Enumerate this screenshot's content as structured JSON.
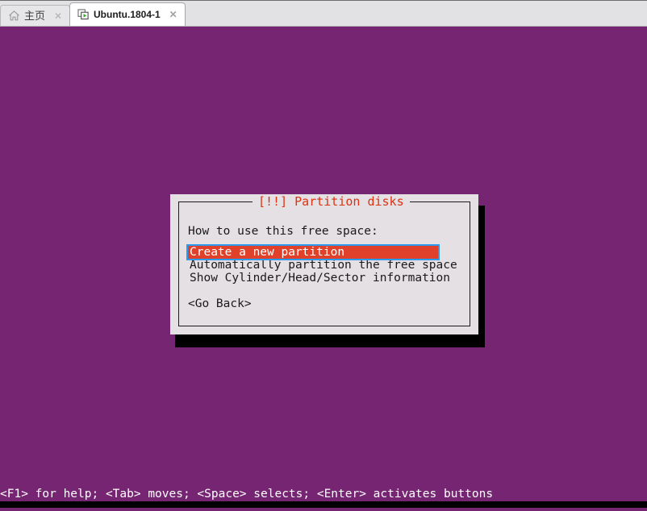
{
  "window": {
    "tabs": [
      {
        "label": "主页",
        "icon": "home-icon",
        "close_glyph": "✕",
        "active": false
      },
      {
        "label": "Ubuntu.1804-1",
        "icon": "virtual-machine-icon",
        "close_glyph": "✕",
        "active": true
      }
    ]
  },
  "console": {
    "background_color": "#762572",
    "dialog": {
      "title": "[!!] Partition disks",
      "title_color": "#dd3311",
      "background_color": "#e4e0e4",
      "prompt": "How to use this free space:",
      "menu_items": [
        {
          "label": "Create a new partition",
          "selected": true
        },
        {
          "label": "Automatically partition the free space",
          "selected": false
        },
        {
          "label": "Show Cylinder/Head/Sector information",
          "selected": false
        }
      ],
      "selected_background_color": "#e0412a",
      "focus_border_color": "#2a9bef",
      "go_back_button": "<Go Back>"
    },
    "status_bar": "<F1> for help; <Tab> moves; <Space> selects; <Enter> activates buttons"
  }
}
